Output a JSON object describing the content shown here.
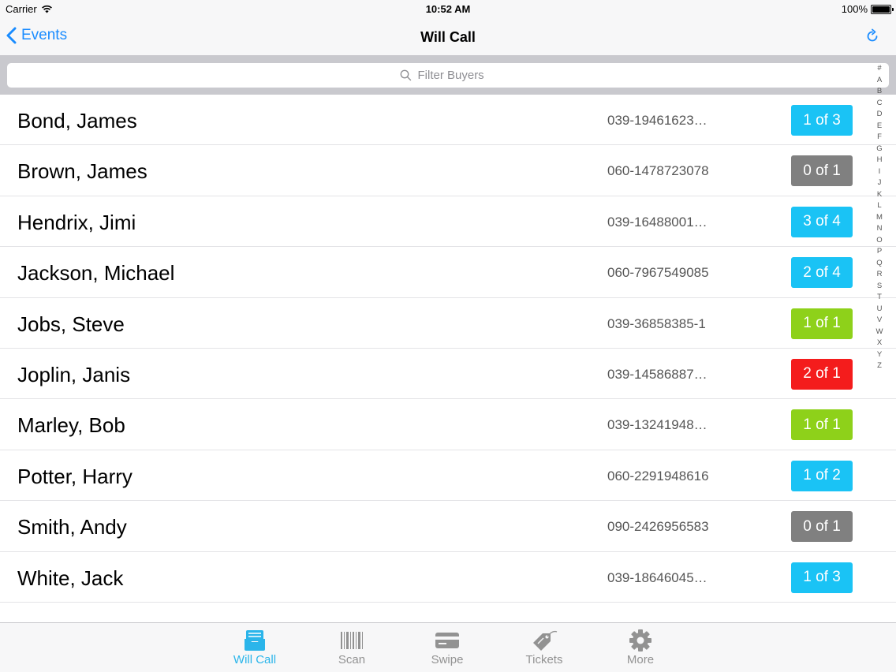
{
  "status_bar": {
    "carrier": "Carrier",
    "time": "10:52 AM",
    "battery": "100%"
  },
  "nav": {
    "back_label": "Events",
    "title": "Will Call"
  },
  "search": {
    "placeholder": "Filter Buyers"
  },
  "index_letters": [
    "#",
    "A",
    "B",
    "C",
    "D",
    "E",
    "F",
    "G",
    "H",
    "I",
    "J",
    "K",
    "L",
    "M",
    "N",
    "O",
    "P",
    "Q",
    "R",
    "S",
    "T",
    "U",
    "V",
    "W",
    "X",
    "Y",
    "Z"
  ],
  "buyers": [
    {
      "name": "Bond, James",
      "order": "039-19461623…",
      "badge": "1 of 3",
      "color": "#1ac3f5"
    },
    {
      "name": "Brown, James",
      "order": "060-1478723078",
      "badge": "0 of 1",
      "color": "#808080"
    },
    {
      "name": "Hendrix, Jimi",
      "order": "039-16488001…",
      "badge": "3 of 4",
      "color": "#1ac3f5"
    },
    {
      "name": "Jackson, Michael",
      "order": "060-7967549085",
      "badge": "2 of 4",
      "color": "#1ac3f5"
    },
    {
      "name": "Jobs, Steve",
      "order": "039-36858385-1",
      "badge": "1 of 1",
      "color": "#8ed11a"
    },
    {
      "name": "Joplin, Janis",
      "order": "039-14586887…",
      "badge": "2 of 1",
      "color": "#f41c1c"
    },
    {
      "name": "Marley, Bob",
      "order": "039-13241948…",
      "badge": "1 of 1",
      "color": "#8ed11a"
    },
    {
      "name": "Potter, Harry",
      "order": "060-2291948616",
      "badge": "1 of 2",
      "color": "#1ac3f5"
    },
    {
      "name": "Smith, Andy",
      "order": "090-2426956583",
      "badge": "0 of 1",
      "color": "#808080"
    },
    {
      "name": "White, Jack",
      "order": "039-18646045…",
      "badge": "1 of 3",
      "color": "#1ac3f5"
    }
  ],
  "tabs": [
    {
      "label": "Will Call",
      "icon": "inbox-tray-icon",
      "active": true
    },
    {
      "label": "Scan",
      "icon": "barcode-icon",
      "active": false
    },
    {
      "label": "Swipe",
      "icon": "credit-card-icon",
      "active": false
    },
    {
      "label": "Tickets",
      "icon": "ticket-tag-icon",
      "active": false
    },
    {
      "label": "More",
      "icon": "gear-icon",
      "active": false
    }
  ],
  "colors": {
    "accent": "#1a8cff",
    "tab_active": "#2bb5ea",
    "tab_inactive": "#929292"
  }
}
